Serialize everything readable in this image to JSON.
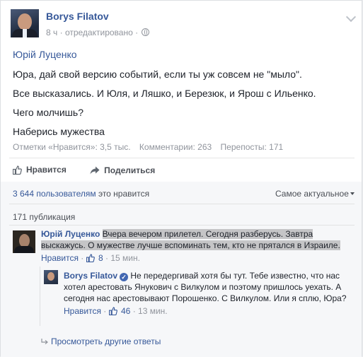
{
  "post": {
    "author": "Borys Filatov",
    "time": "8 ч",
    "edited": "· отредактировано ·",
    "mention": "Юрій Луценко",
    "lines": [
      "Юра, дай свой версию событий, если ты уж совсем не \"мыло\".",
      "Все высказались. И Юля, и Ляшко, и Березюк, и Ярош с Ильенко.",
      "Чего молчишь?",
      "Наберись мужества"
    ]
  },
  "stats": {
    "likes": "Отметки «Нравится»: 3,5 тыс.",
    "comments": "Комментарии: 263",
    "shares": "Перепосты: 171"
  },
  "actions": {
    "like": "Нравится",
    "share": "Поделиться"
  },
  "comments_section": {
    "likes_count": "3 644 пользователям",
    "likes_suffix": "это нравится",
    "sort": "Самое актуальное",
    "publications": "171 публикация"
  },
  "comment1": {
    "author": "Юрій Луценко",
    "text": "Вчера вечером прилетел. Сегодня разберусь. Завтра выскажусь. О мужестве лучше вспоминать тем, кто не прятался в Израиле.",
    "like": "Нравится",
    "likes": "8",
    "time": "15 мин."
  },
  "reply1": {
    "author": "Borys Filatov",
    "text": "Не передергивай хотя бы тут. Тебе известно, что нас хотел арестовать Янукович с Вилкулом и поэтому пришлось уехать. А сегодня нас арестовывают Порошенко. С Вилкулом. Или я сплю, Юра?",
    "like": "Нравится",
    "likes": "46",
    "time": "13 мин."
  },
  "more_replies": "Просмотреть другие ответы",
  "colors": {
    "link": "#365899",
    "meta": "#90949c",
    "background": "#f6f7f9"
  }
}
